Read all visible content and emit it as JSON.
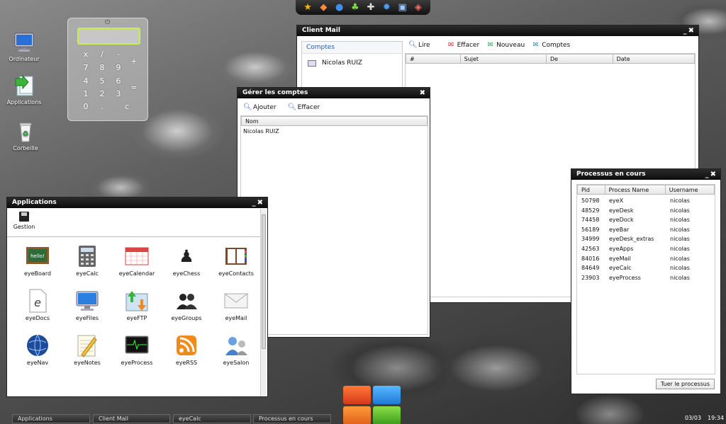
{
  "desktop": {
    "icons": [
      {
        "label": "Ordinateur"
      },
      {
        "label": "Applications"
      },
      {
        "label": "Corbeille"
      }
    ]
  },
  "dock": {
    "items": [
      "star-icon",
      "paint-icon",
      "globe-icon",
      "colors-icon",
      "gamepad-icon",
      "gear-icon",
      "monitor-icon",
      "palette-icon"
    ]
  },
  "calculator": {
    "keys": [
      "x",
      "/",
      "-",
      "+",
      "7",
      "8",
      "9",
      "4",
      "5",
      "6",
      "=",
      "1",
      "2",
      "3",
      "0",
      ".",
      "c"
    ]
  },
  "mail": {
    "title": "Client Mail",
    "folder_header": "Comptes",
    "account": "Nicolas RUIZ",
    "toolbar": {
      "read": "Lire",
      "delete": "Effacer",
      "new": "Nouveau",
      "accounts": "Comptes"
    },
    "columns": {
      "num": "#",
      "subject": "Sujet",
      "from": "De",
      "date": "Date"
    }
  },
  "accounts": {
    "title": "Gérer les comptes",
    "toolbar": {
      "add": "Ajouter",
      "delete": "Effacer"
    },
    "column": "Nom",
    "rows": [
      "Nicolas RUIZ"
    ]
  },
  "applications": {
    "title": "Applications",
    "manage": "Gestion",
    "apps": [
      "eyeBoard",
      "eyeCalc",
      "eyeCalendar",
      "eyeChess",
      "eyeContacts",
      "eyeDocs",
      "eyeFiles",
      "eyeFTP",
      "eyeGroups",
      "eyeMail",
      "eyeNav",
      "eyeNotes",
      "eyeProcess",
      "eyeRSS",
      "eyeSalon"
    ]
  },
  "processes": {
    "title": "Processus en cours",
    "columns": {
      "pid": "Pid",
      "name": "Process Name",
      "user": "Username"
    },
    "rows": [
      {
        "pid": "50798",
        "name": "eyeX",
        "user": "nicolas"
      },
      {
        "pid": "48529",
        "name": "eyeDesk",
        "user": "nicolas"
      },
      {
        "pid": "74458",
        "name": "eyeDock",
        "user": "nicolas"
      },
      {
        "pid": "56189",
        "name": "eyeBar",
        "user": "nicolas"
      },
      {
        "pid": "34999",
        "name": "eyeDesk_extras",
        "user": "nicolas"
      },
      {
        "pid": "42563",
        "name": "eyeApps",
        "user": "nicolas"
      },
      {
        "pid": "84016",
        "name": "eyeMail",
        "user": "nicolas"
      },
      {
        "pid": "84649",
        "name": "eyeCalc",
        "user": "nicolas"
      },
      {
        "pid": "23903",
        "name": "eyeProcess",
        "user": "nicolas"
      }
    ],
    "kill_button": "Tuer le processus"
  },
  "taskbar": {
    "tasks": [
      "Applications",
      "Client Mail",
      "eyeCalc",
      "Processus en cours"
    ],
    "date": "03/03",
    "time": "19:34"
  }
}
